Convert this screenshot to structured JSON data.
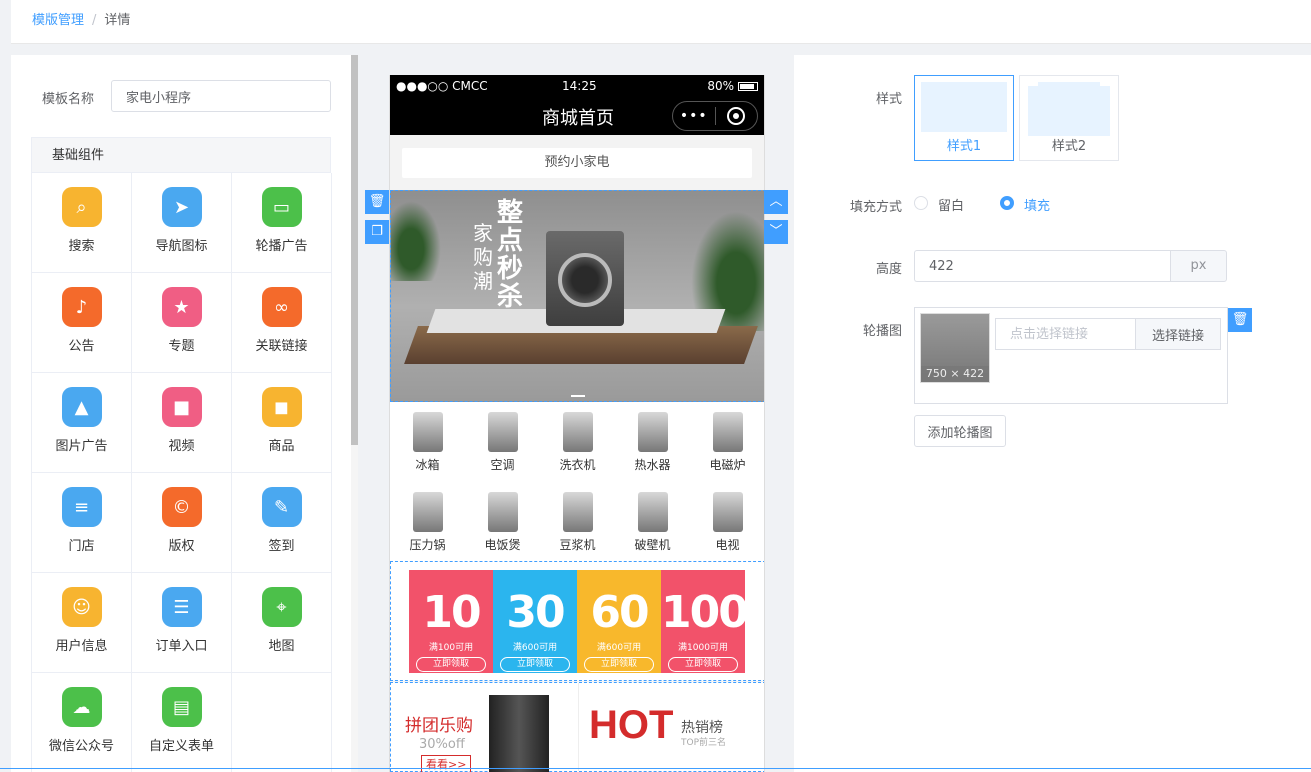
{
  "breadcrumb": {
    "parent": "模版管理",
    "separator": "/",
    "current": "详情"
  },
  "template": {
    "name_label": "模板名称",
    "name_value": "家电小程序"
  },
  "components": {
    "group_title": "基础组件",
    "items": [
      {
        "label": "搜索",
        "icon": "search-icon",
        "color": "#f7b430",
        "glyph": "⌕"
      },
      {
        "label": "导航图标",
        "icon": "navigation-icon",
        "color": "#4aa8f0",
        "glyph": "➤"
      },
      {
        "label": "轮播广告",
        "icon": "carousel-icon",
        "color": "#4cc04a",
        "glyph": "▭"
      },
      {
        "label": "公告",
        "icon": "speaker-icon",
        "color": "#f46a2b",
        "glyph": "♪"
      },
      {
        "label": "专题",
        "icon": "badge-icon",
        "color": "#f05e84",
        "glyph": "★"
      },
      {
        "label": "关联链接",
        "icon": "link-icon",
        "color": "#f46a2b",
        "glyph": "∞"
      },
      {
        "label": "图片广告",
        "icon": "image-icon",
        "color": "#4aa8f0",
        "glyph": "▲"
      },
      {
        "label": "视频",
        "icon": "video-icon",
        "color": "#f05e84",
        "glyph": "■"
      },
      {
        "label": "商品",
        "icon": "shopping-bag-icon",
        "color": "#f7b430",
        "glyph": "◼"
      },
      {
        "label": "门店",
        "icon": "store-icon",
        "color": "#4aa8f0",
        "glyph": "≡"
      },
      {
        "label": "版权",
        "icon": "copyright-icon",
        "color": "#f46a2b",
        "glyph": "©"
      },
      {
        "label": "签到",
        "icon": "pencil-icon",
        "color": "#4aa8f0",
        "glyph": "✎"
      },
      {
        "label": "用户信息",
        "icon": "user-card-icon",
        "color": "#f7b430",
        "glyph": "☺"
      },
      {
        "label": "订单入口",
        "icon": "clipboard-icon",
        "color": "#4aa8f0",
        "glyph": "☰"
      },
      {
        "label": "地图",
        "icon": "map-pin-icon",
        "color": "#4cc04a",
        "glyph": "⌖"
      },
      {
        "label": "微信公众号",
        "icon": "wechat-icon",
        "color": "#4cc04a",
        "glyph": "☁"
      },
      {
        "label": "自定义表单",
        "icon": "form-icon",
        "color": "#4cc04a",
        "glyph": "▤"
      }
    ]
  },
  "phone": {
    "status": {
      "carrier": "●●●○○ CMCC",
      "time": "14:25",
      "battery": "80%"
    },
    "title": "商城首页",
    "capsule_dots": "•••",
    "search_placeholder": "预约小家电",
    "banner": {
      "text_big": "整点秒杀",
      "text_small": "家购潮"
    },
    "categories_row1": [
      "冰箱",
      "空调",
      "洗衣机",
      "热水器",
      "电磁炉"
    ],
    "categories_row2": [
      "压力锅",
      "电饭煲",
      "豆浆机",
      "破壁机",
      "电视"
    ],
    "coupons": [
      {
        "value": "10",
        "cond": "满100可用",
        "btn": "立即领取",
        "color": "#f2526a"
      },
      {
        "value": "30",
        "cond": "满600可用",
        "btn": "立即领取",
        "color": "#2bb5ee"
      },
      {
        "value": "60",
        "cond": "满600可用",
        "btn": "立即领取",
        "color": "#f8b82c"
      },
      {
        "value": "100",
        "cond": "满1000可用",
        "btn": "立即领取",
        "color": "#f2526a"
      }
    ],
    "promo": {
      "title": "拼团乐购",
      "sub": "30%off",
      "btn": "看看>>",
      "hot": "HOT",
      "hot_sub": "热销榜",
      "hot_sub2": "TOP前三名"
    }
  },
  "settings": {
    "style_label": "样式",
    "styles": [
      "样式1",
      "样式2"
    ],
    "fill_label": "填充方式",
    "fill_options": [
      "留白",
      "填充"
    ],
    "height_label": "高度",
    "height_value": "422",
    "height_unit": "px",
    "carousel_label": "轮播图",
    "thumb_caption": "750 × 422",
    "link_placeholder": "点击选择链接",
    "link_button": "选择链接",
    "add_button": "添加轮播图"
  }
}
